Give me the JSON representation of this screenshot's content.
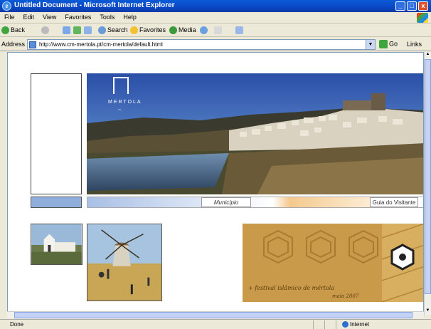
{
  "window": {
    "title": "Untitled Document - Microsoft Internet Explorer",
    "controls": [
      "_",
      "□",
      "x"
    ]
  },
  "menu": [
    "File",
    "Edit",
    "View",
    "Favorites",
    "Tools",
    "Help"
  ],
  "toolbar": {
    "back": "Back",
    "search": "Search",
    "favorites": "Favorites",
    "media": "Media"
  },
  "address": {
    "label": "Address",
    "url": "http://www.cm-mertola.pt/cm-mertola/default.html",
    "go": "Go",
    "links": "Links"
  },
  "page": {
    "logo_text": "MERTOLA",
    "nav": {
      "municipio": "Município",
      "guia": "Guia do Visitante"
    },
    "festival": {
      "line1": "+ festival islâmico de mértola",
      "line2": "maio 2007"
    }
  },
  "status": {
    "left": "Done",
    "zone": "Internet"
  },
  "colors": {
    "titlebar": "#0a46c4",
    "nav_blue": "#8faedb",
    "festival_gold": "#c99a4a"
  }
}
